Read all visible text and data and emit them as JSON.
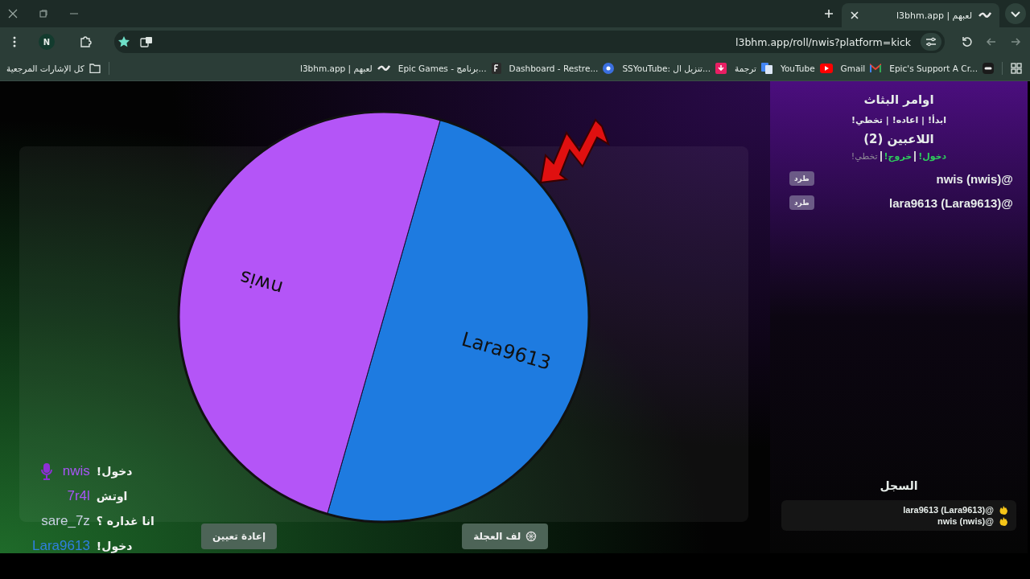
{
  "browser": {
    "tab": {
      "title": "لعبهم | l3bhm.app",
      "selected": true
    },
    "profile": "N",
    "url": "l3bhm.app/roll/nwis?platform=kick",
    "bookmarks": [
      {
        "title": "Epic's Support A Cr..."
      },
      {
        "title": "Gmail"
      },
      {
        "title": "YouTube"
      },
      {
        "title": "ترجمة"
      },
      {
        "title": "SSYouTube: تنزيل ال..."
      },
      {
        "title": "Dashboard - Restre..."
      },
      {
        "title": "Epic Games - برنامج..."
      },
      {
        "title": "لعبهم | l3bhm.app"
      }
    ],
    "all_bookmarks": "كل الإشارات المرجعية"
  },
  "wheel": {
    "segments": [
      {
        "label": "Lara9613",
        "color": "#1e7be0"
      },
      {
        "label": "nwis",
        "color": "#b455f7"
      }
    ]
  },
  "controls": [
    {
      "label": "لف العجلة",
      "kind": "spin"
    },
    {
      "label": "إعادة تعيين",
      "kind": "reset"
    }
  ],
  "chat": [
    {
      "user": "nwis",
      "message": "!دخول",
      "color": "#a855f7",
      "badge": true
    },
    {
      "user": "7r4l",
      "message": "اوتش",
      "color": "#a855f7",
      "badge": false
    },
    {
      "user": "sare_7z",
      "message": "انا غداره ؟",
      "color": "#c9d1e3",
      "badge": false
    },
    {
      "user": "Lara9613",
      "message": "!دخول",
      "color": "#2f7fe0",
      "badge": false
    }
  ],
  "panel": {
    "title": "اوامر البثاث",
    "commands": "ابدأ! | اعاده! | تخطي!",
    "players_title": "اللاعبين (2)",
    "player_commands": [
      {
        "text": "دخول!",
        "active": true
      },
      {
        "text": "خروج!",
        "active": true
      },
      {
        "text": "تخطي!",
        "active": false
      }
    ],
    "players": [
      {
        "name": "@nwis (nwis)",
        "action": "طرد"
      },
      {
        "name": "@lara9613 (Lara9613)",
        "action": "طرد"
      }
    ],
    "log_title": "السجل",
    "log": [
      {
        "text": "@lara9613 (Lara9613)"
      },
      {
        "text": "@nwis (nwis)"
      }
    ]
  }
}
